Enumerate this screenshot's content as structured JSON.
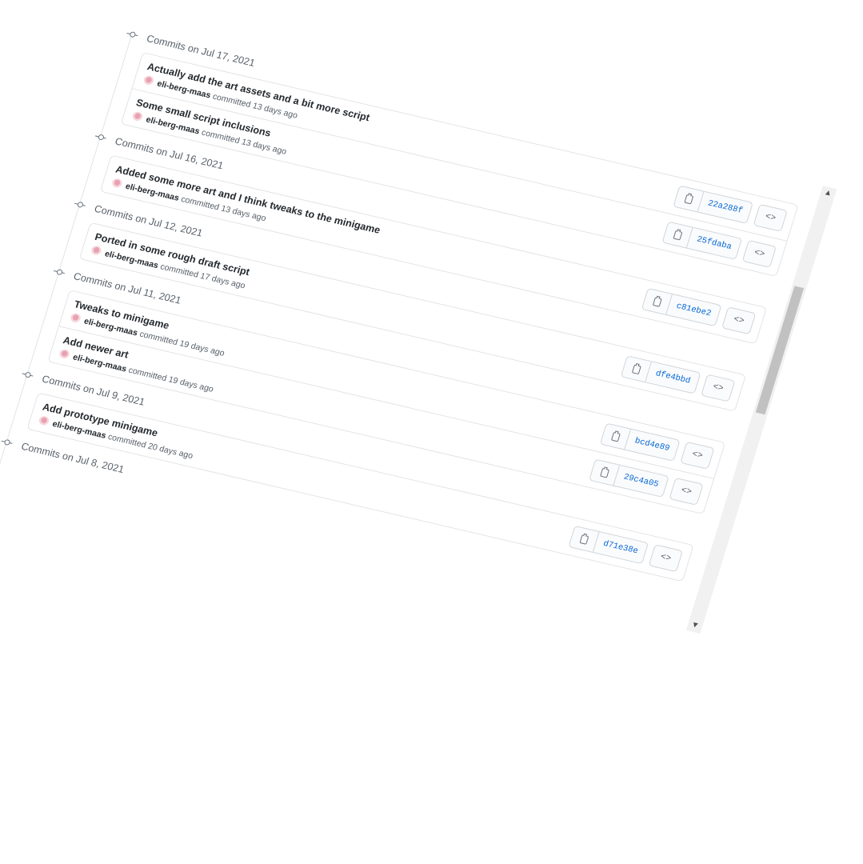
{
  "groups": [
    {
      "header": "Commits on Jul 17, 2021",
      "commits": [
        {
          "message": "Actually add the art assets and a bit more script",
          "author": "eli-berg-maas",
          "time": "committed 13 days ago",
          "sha": "22a288f"
        },
        {
          "message": "Some small script inclusions",
          "author": "eli-berg-maas",
          "time": "committed 13 days ago",
          "sha": "25fdaba"
        }
      ]
    },
    {
      "header": "Commits on Jul 16, 2021",
      "commits": [
        {
          "message": "Added some more art and I think tweaks to the minigame",
          "author": "eli-berg-maas",
          "time": "committed 13 days ago",
          "sha": "c81ebe2"
        }
      ]
    },
    {
      "header": "Commits on Jul 12, 2021",
      "commits": [
        {
          "message": "Ported in some rough draft script",
          "author": "eli-berg-maas",
          "time": "committed 17 days ago",
          "sha": "dfe4bbd"
        }
      ]
    },
    {
      "header": "Commits on Jul 11, 2021",
      "commits": [
        {
          "message": "Tweaks to minigame",
          "author": "eli-berg-maas",
          "time": "committed 19 days ago",
          "sha": "bcd4e89"
        },
        {
          "message": "Add newer art",
          "author": "eli-berg-maas",
          "time": "committed 19 days ago",
          "sha": "29c4a05"
        }
      ]
    },
    {
      "header": "Commits on Jul 9, 2021",
      "commits": [
        {
          "message": "Add prototype minigame",
          "author": "eli-berg-maas",
          "time": "committed 20 days ago",
          "sha": "d71e38e"
        }
      ]
    },
    {
      "header": "Commits on Jul 8, 2021",
      "commits": []
    }
  ],
  "icons": {
    "copy": "clipboard-icon",
    "browse": "code-icon",
    "browse_glyph": "<>",
    "node": "git-commit-icon",
    "scroll_up": "▲",
    "scroll_down": "▼"
  }
}
